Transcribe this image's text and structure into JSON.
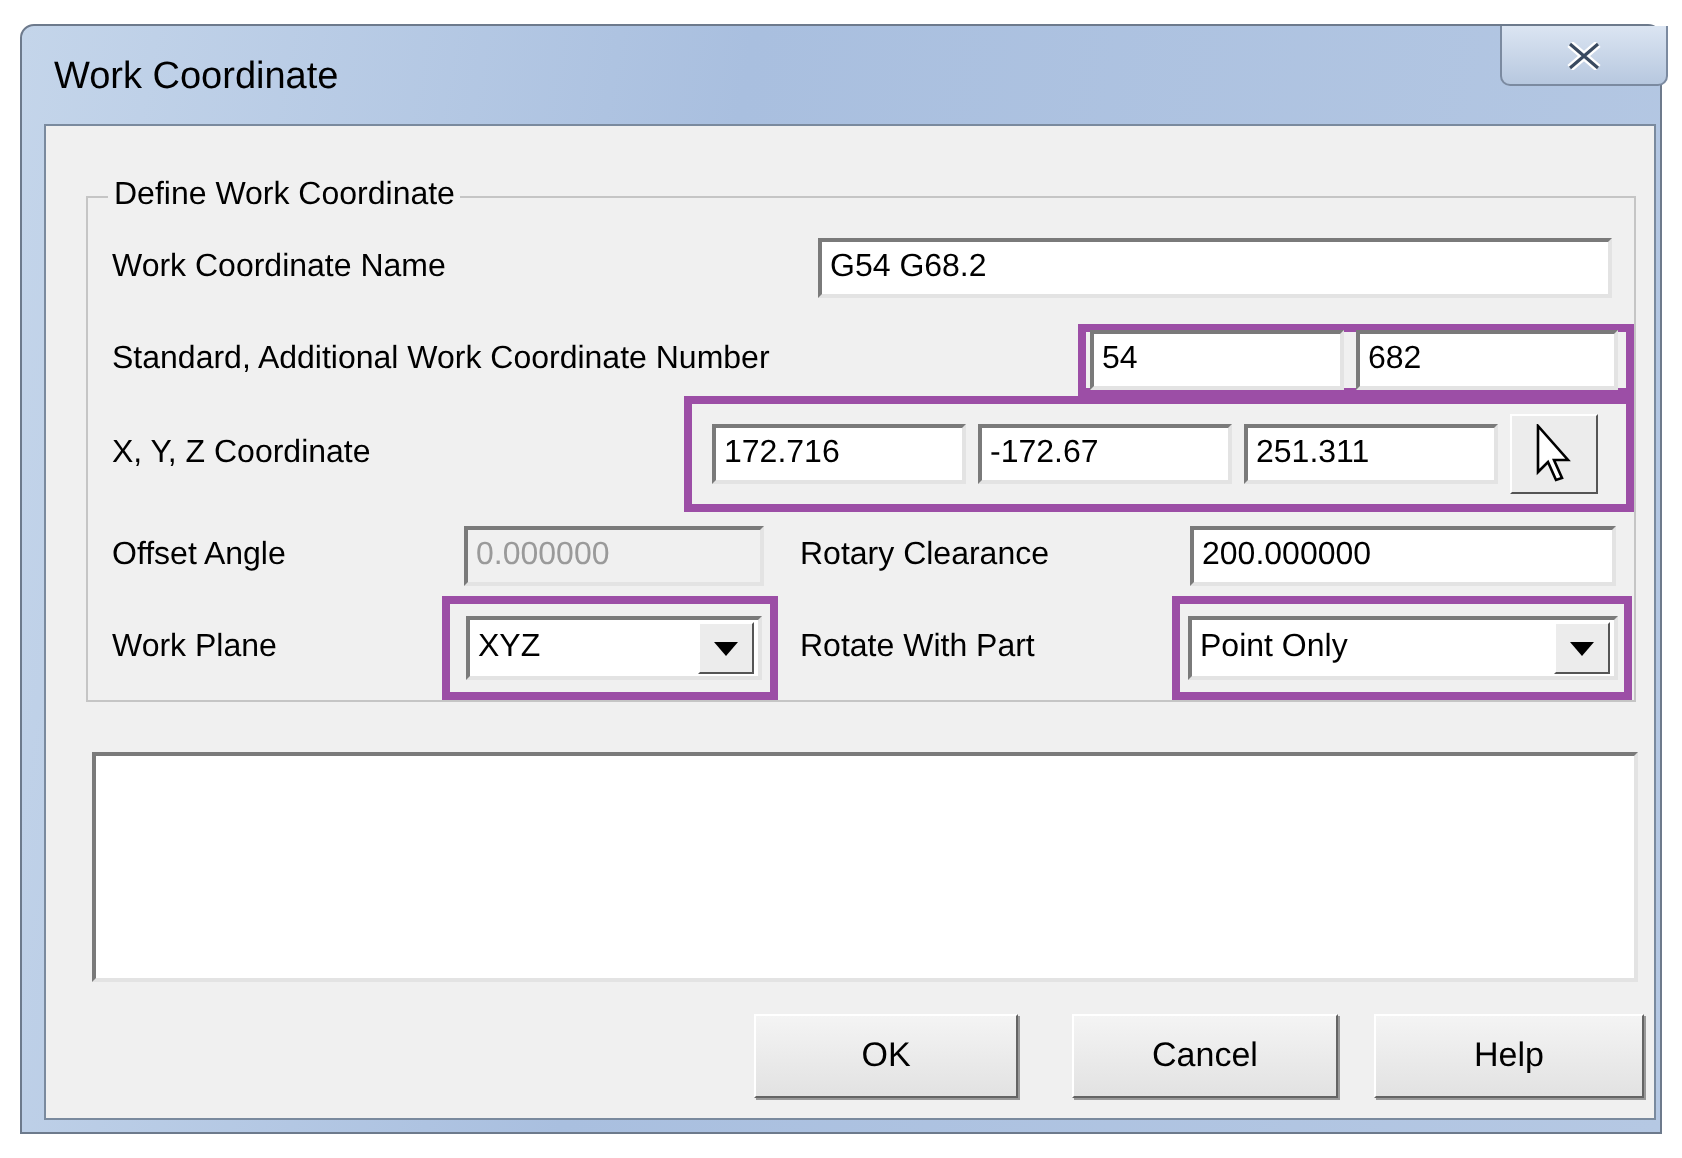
{
  "window": {
    "title": "Work Coordinate"
  },
  "group": {
    "title": "Define Work Coordinate",
    "name": {
      "label": "Work Coordinate Name",
      "value": "G54 G68.2"
    },
    "numbers": {
      "label": "Standard, Additional Work Coordinate Number",
      "highlighted": true,
      "values": [
        "54",
        "682"
      ]
    },
    "coordinate": {
      "label": "X, Y, Z Coordinate",
      "highlighted": true,
      "values": [
        "172.716",
        "-172.67",
        "251.311"
      ]
    },
    "offset_angle": {
      "label": "Offset Angle",
      "value": "0.000000",
      "disabled": true
    },
    "rotary_clearance": {
      "label": "Rotary Clearance",
      "value": "200.000000",
      "disabled": false
    },
    "work_plane": {
      "label": "Work Plane",
      "value": "XYZ",
      "highlighted": true
    },
    "rotate_with_part": {
      "label": "Rotate With Part",
      "value": "Point Only",
      "highlighted": true
    }
  },
  "buttons": [
    "OK",
    "Cancel",
    "Help"
  ]
}
